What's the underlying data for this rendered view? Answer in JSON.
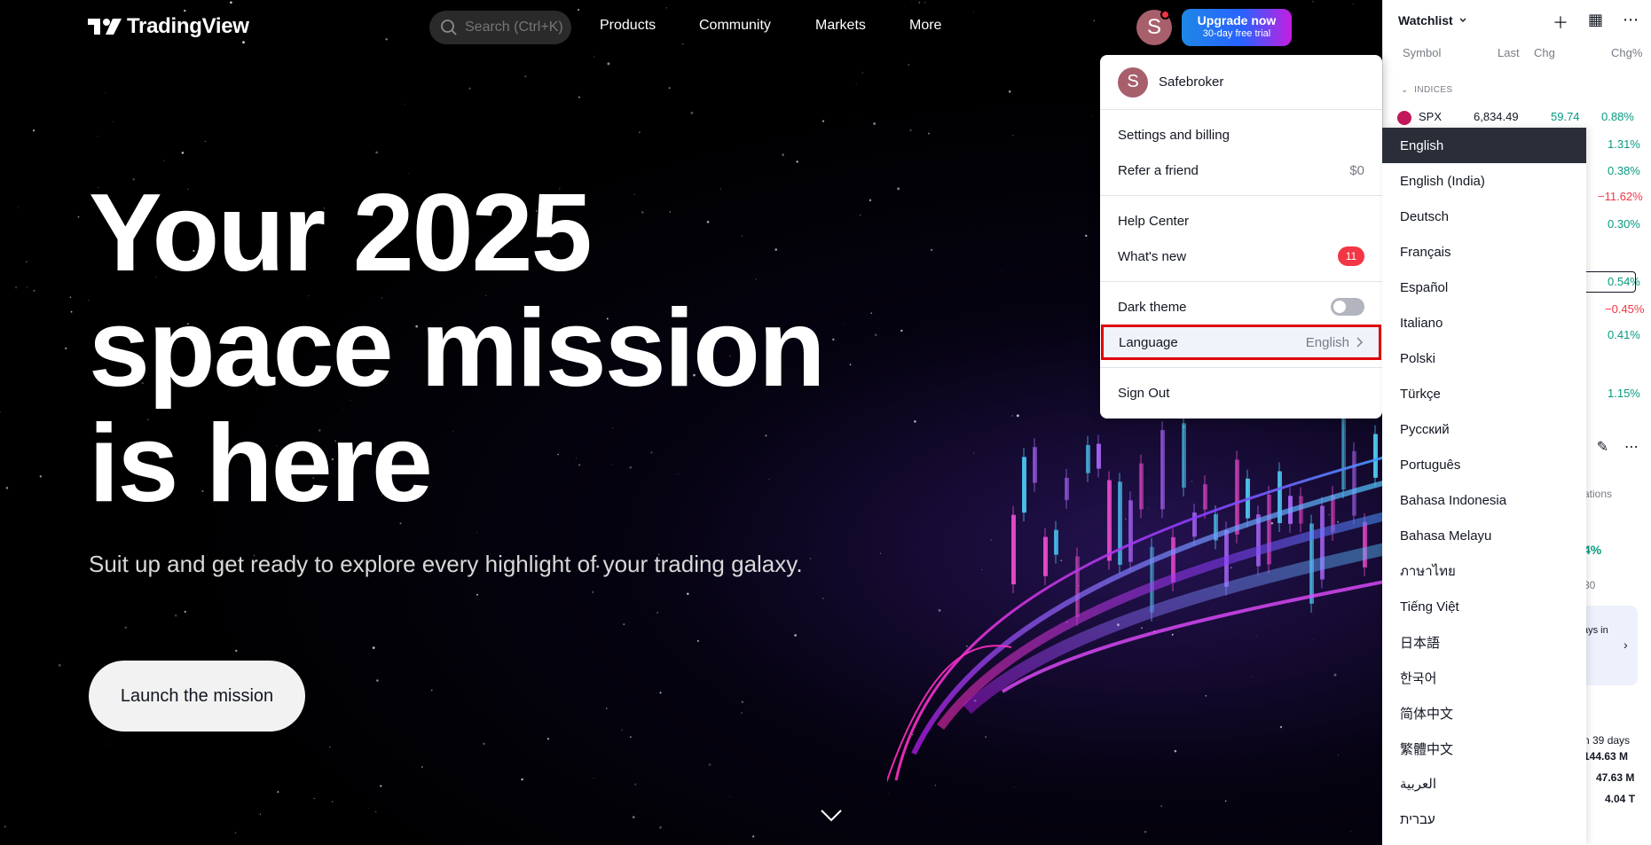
{
  "nav": {
    "logo_text": "TradingView",
    "search_placeholder": "Search (Ctrl+K)",
    "links": [
      "Products",
      "Community",
      "Markets",
      "More"
    ],
    "avatar_letter": "S",
    "upgrade_line1": "Upgrade now",
    "upgrade_line2": "30-day free trial"
  },
  "hero": {
    "headline_1": "Your 2025",
    "headline_2": "space mission",
    "headline_3": "is here",
    "subline": "Suit up and get ready to explore every highlight of your trading galaxy.",
    "cta": "Launch the mission"
  },
  "user_menu": {
    "username": "Safebroker",
    "settings": "Settings and billing",
    "refer": "Refer a friend",
    "refer_value": "$0",
    "help": "Help Center",
    "whats_new": "What's new",
    "whats_new_count": "11",
    "dark_theme": "Dark theme",
    "language": "Language",
    "language_value": "English",
    "sign_out": "Sign Out"
  },
  "watchlist": {
    "title": "Watchlist",
    "columns": [
      "Symbol",
      "Last",
      "Chg",
      "Chg%"
    ],
    "group": "INDICES",
    "first_row": {
      "symbol": "SPX",
      "last": "6,834.49",
      "chg": "59.74",
      "chgp": "0.88%"
    },
    "chg_pct_visible": [
      "1.31%",
      "0.38%",
      "−11.62%",
      "0.30%",
      "0.54%",
      "−0.45%",
      "0.41%",
      "1.15%"
    ],
    "partials": [
      "ations",
      "4%",
      "30",
      "ays in",
      "n 39 days",
      "144.63 M",
      "47.63 M",
      "4.04 T"
    ]
  },
  "languages": {
    "selected": "English",
    "items": [
      "English",
      "English (India)",
      "Deutsch",
      "Français",
      "Español",
      "Italiano",
      "Polski",
      "Türkçe",
      "Русский",
      "Português",
      "Bahasa Indonesia",
      "Bahasa Melayu",
      "ภาษาไทย",
      "Tiếng Việt",
      "日本語",
      "한국어",
      "简体中文",
      "繁體中文",
      "العربية",
      "עברית"
    ]
  },
  "colors": {
    "accent_blue": "#2962ff",
    "positive": "#089981",
    "negative": "#f23645",
    "highlight_border": "#e0000d"
  }
}
